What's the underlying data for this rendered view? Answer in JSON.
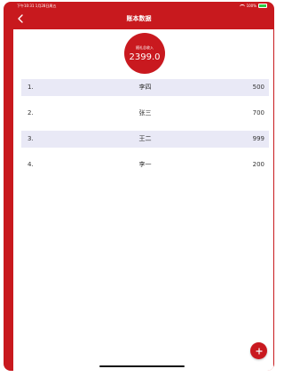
{
  "status_bar": {
    "time_text": "下午10:31 1月28日周五",
    "battery_text": "100%"
  },
  "navigation": {
    "title": "账本数据",
    "back_icon": "chevron-left-icon"
  },
  "summary": {
    "label": "随礼总收入",
    "total": "2399.0"
  },
  "ledger": {
    "rows": [
      {
        "index": "1.",
        "name": "李四",
        "amount": "500",
        "shaded": true
      },
      {
        "index": "2.",
        "name": "张三",
        "amount": "700",
        "shaded": false
      },
      {
        "index": "3.",
        "name": "王二",
        "amount": "999",
        "shaded": true
      },
      {
        "index": "4.",
        "name": "李一",
        "amount": "200",
        "shaded": false
      }
    ]
  },
  "fab": {
    "icon": "plus-icon",
    "label": "+"
  },
  "colors": {
    "primary_red": "#c8191e",
    "row_shade": "#e9e9f6",
    "battery_green": "#2ecc45"
  }
}
